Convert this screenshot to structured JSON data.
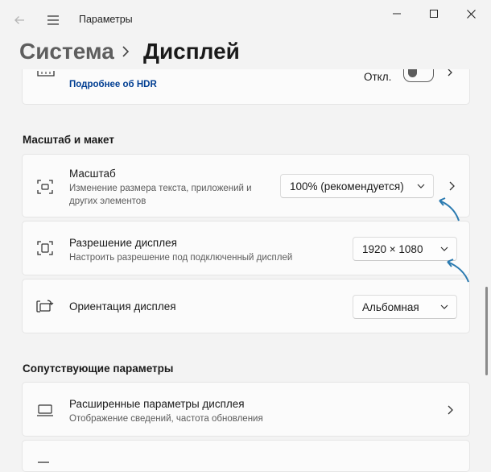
{
  "window": {
    "app_title": "Параметры",
    "colors": {
      "accent": "#0067c0",
      "arrow": "#2a7ab0",
      "background": "#f3f3f3"
    }
  },
  "breadcrumb": {
    "parent": "Система",
    "current": "Дисплей"
  },
  "hdr_card": {
    "link": "Подробнее об HDR",
    "toggle_state": "Откл."
  },
  "scale_section": {
    "heading": "Масштаб и макет",
    "scale": {
      "title": "Масштаб",
      "subtitle_line1": "Изменение размера текста, приложений и",
      "subtitle_line2": "других элементов",
      "value": "100% (рекомендуется)"
    },
    "resolution": {
      "title": "Разрешение дисплея",
      "subtitle": "Настроить разрешение под подключенный дисплей",
      "value": "1920 × 1080"
    },
    "orientation": {
      "title": "Ориентация дисплея",
      "value": "Альбомная"
    }
  },
  "related_section": {
    "heading": "Сопутствующие параметры",
    "advanced": {
      "title": "Расширенные параметры дисплея",
      "subtitle": "Отображение сведений, частота обновления"
    }
  }
}
